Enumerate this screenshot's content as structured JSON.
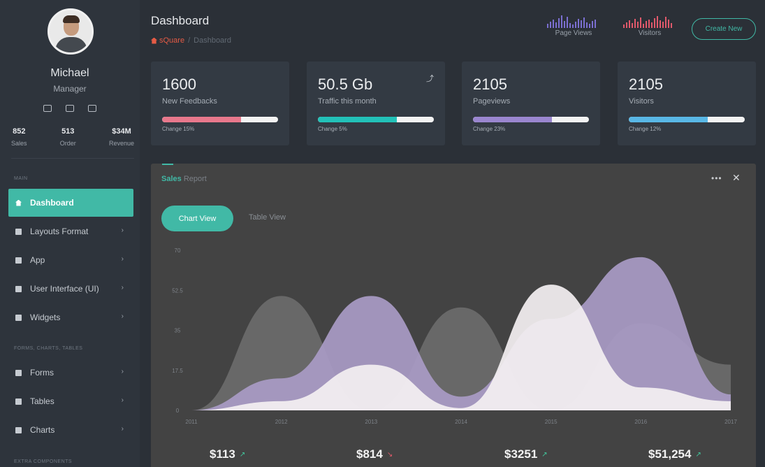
{
  "user": {
    "name": "Michael",
    "role": "Manager",
    "stats": [
      {
        "value": "852",
        "label": "Sales"
      },
      {
        "value": "513",
        "label": "Order"
      },
      {
        "value": "$34M",
        "label": "Revenue"
      }
    ]
  },
  "sidebar": {
    "section_main": "MAIN",
    "section_forms": "FORMS, CHARTS, TABLES",
    "section_extra": "EXTRA COMPONENTS",
    "items": [
      {
        "label": "Dashboard",
        "icon": "home-icon",
        "active": true
      },
      {
        "label": "Layouts Format",
        "icon": "layout-icon"
      },
      {
        "label": "App",
        "icon": "app-icon"
      },
      {
        "label": "User Interface (UI)",
        "icon": "ui-icon"
      },
      {
        "label": "Widgets",
        "icon": "widgets-icon"
      },
      {
        "label": "Forms",
        "icon": "forms-icon"
      },
      {
        "label": "Tables",
        "icon": "tables-icon"
      },
      {
        "label": "Charts",
        "icon": "charts-icon"
      }
    ]
  },
  "header": {
    "title": "Dashboard",
    "breadcrumb_home": "sQuare",
    "breadcrumb_sep": "/",
    "breadcrumb_current": "Dashboard",
    "page_views_label": "Page Views",
    "visitors_label": "Visitors",
    "create_button": "Create New",
    "colors": {
      "page_views": "#7b6fd1",
      "visitors": "#e0596b"
    }
  },
  "cards": [
    {
      "value": "1600",
      "caption": "New Feedbacks",
      "change": "Change 15%",
      "progress": 0.68,
      "color": "#e8788c"
    },
    {
      "value": "50.5 Gb",
      "caption": "Traffic this month",
      "change": "Change 5%",
      "progress": 0.68,
      "color": "#22c1b8",
      "trend_icon": "trend-up-icon"
    },
    {
      "value": "2105",
      "caption": "Pageviews",
      "change": "Change 23%",
      "progress": 0.68,
      "color": "#9a86cf"
    },
    {
      "value": "2105",
      "caption": "Visitors",
      "change": "Change 12%",
      "progress": 0.68,
      "color": "#59b7e6"
    }
  ],
  "sales": {
    "title_a": "Sales",
    "title_b": "Report",
    "dots": "•••",
    "close": "✕",
    "tab_chart": "Chart View",
    "tab_table": "Table View",
    "bottom": [
      {
        "value": "$113",
        "trend": "up",
        "arrow": "↗"
      },
      {
        "value": "$814",
        "trend": "down",
        "arrow": "↘"
      },
      {
        "value": "$3251",
        "trend": "up",
        "arrow": "↗"
      },
      {
        "value": "$51,254",
        "trend": "up",
        "arrow": "↗"
      }
    ],
    "colors": {
      "up": "#41c99e",
      "down": "#e55b6b"
    }
  },
  "chart_data": {
    "type": "area",
    "x": [
      "2011",
      "2012",
      "2013",
      "2014",
      "2015",
      "2016",
      "2017"
    ],
    "y_ticks": [
      "0",
      "17.5",
      "35",
      "52.5",
      "70"
    ],
    "ylim": [
      0,
      70
    ],
    "series": [
      {
        "values": [
          0,
          50,
          0,
          45,
          0,
          38,
          20
        ],
        "color": "#6a6a6a"
      },
      {
        "values": [
          0,
          14,
          50,
          6,
          40,
          67,
          7
        ],
        "color": "#a99bc6"
      },
      {
        "values": [
          0,
          4,
          20,
          1,
          55,
          10,
          4
        ],
        "color": "#f3eff1"
      }
    ]
  }
}
